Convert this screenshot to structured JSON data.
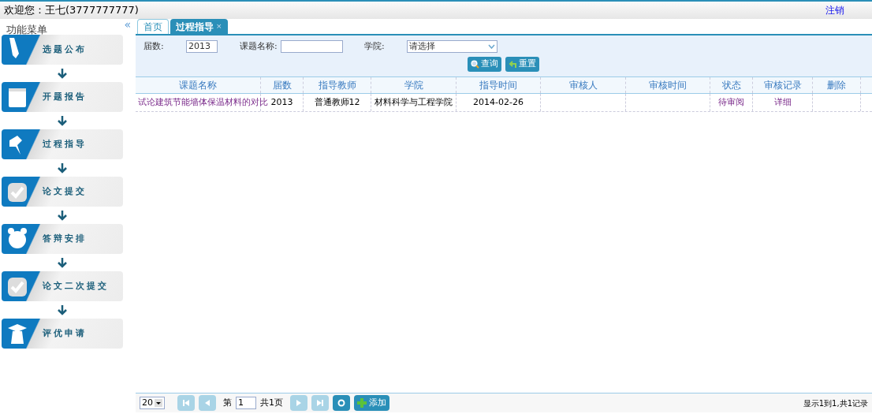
{
  "header": {
    "welcome": "欢迎您：王七(3777777777)",
    "logout": "注销"
  },
  "sidebar": {
    "title": "功能菜单",
    "collapse": "«",
    "items": [
      {
        "label": "选题公布",
        "kind": "pen"
      },
      {
        "label": "开题报告",
        "kind": "notepad"
      },
      {
        "label": "过程指导",
        "kind": "pin"
      },
      {
        "label": "论文提交",
        "kind": "check"
      },
      {
        "label": "答辩安排",
        "kind": "clock"
      },
      {
        "label": "论文二次提交",
        "kind": "check"
      },
      {
        "label": "评优申请",
        "kind": "grad"
      }
    ]
  },
  "tabs": [
    {
      "label": "首页",
      "selected": false
    },
    {
      "label": "过程指导",
      "selected": true,
      "close": "×"
    }
  ],
  "filters": {
    "year_label": "届数:",
    "year_value": "2013",
    "title_label": "课题名称:",
    "college_label": "学院:",
    "college_value": "请选择",
    "search": "查询",
    "reset": "重置"
  },
  "table": {
    "columns": [
      "课题名称",
      "届数",
      "指导教师",
      "学院",
      "指导时间",
      "审核人",
      "审核时间",
      "状态",
      "审核记录",
      "删除"
    ],
    "rows": [
      [
        "试论建筑节能墙体保温材料的对比",
        "2013",
        "普通教师12",
        "材料科学与工程学院",
        "2014-02-26",
        "",
        "",
        "待审阅",
        "详细",
        ""
      ]
    ]
  },
  "pager": {
    "page_size": "20",
    "page_prefix": "第",
    "page": "1",
    "page_total": "共1页",
    "add": "添加",
    "summary": "显示1到1,共1记录"
  }
}
